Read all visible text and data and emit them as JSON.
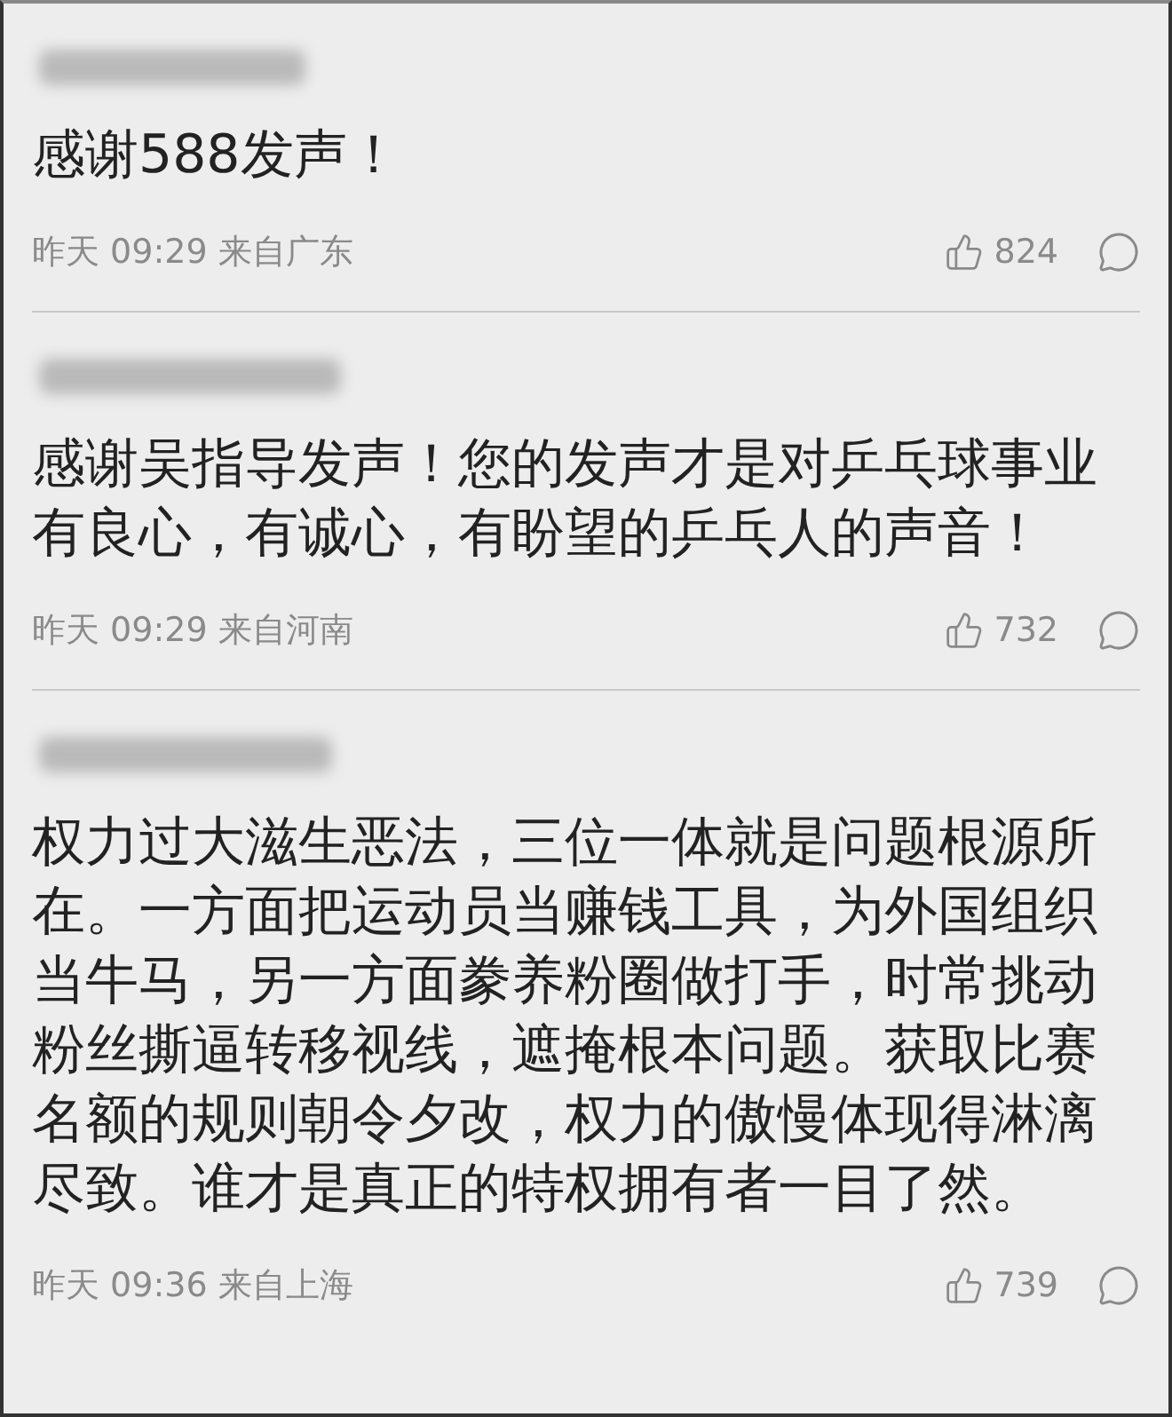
{
  "comments": [
    {
      "text": "感谢588发声！",
      "time": "昨天 09:29 来自广东",
      "likes": "824"
    },
    {
      "text": "感谢吴指导发声！您的发声才是对乒乓球事业有良心，有诚心，有盼望的乒乓人的声音！",
      "time": "昨天 09:29 来自河南",
      "likes": "732"
    },
    {
      "text": "权力过大滋生恶法，三位一体就是问题根源所在。一方面把运动员当赚钱工具，为外国组织当牛马，另一方面豢养粉圈做打手，时常挑动粉丝撕逼转移视线，遮掩根本问题。获取比赛名额的规则朝令夕改，权力的傲慢体现得淋漓尽致。谁才是真正的特权拥有者一目了然。",
      "time": "昨天 09:36 来自上海",
      "likes": "739"
    }
  ]
}
